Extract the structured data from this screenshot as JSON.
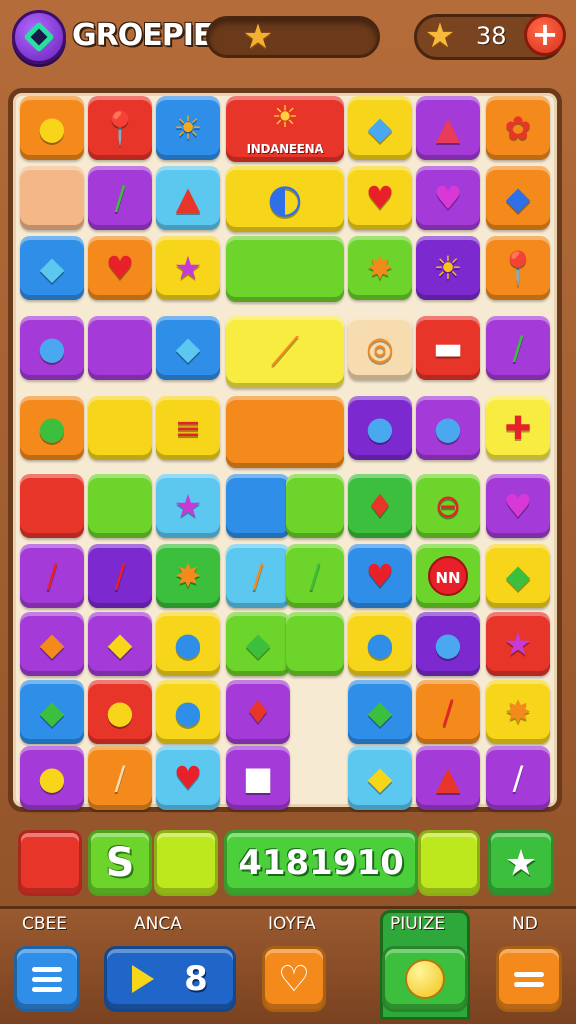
{
  "header": {
    "title": "GROEPIE",
    "coins": "38",
    "colors": {
      "accent": "#a43ad8",
      "plus": "#e8352a"
    }
  },
  "board": {
    "banner_text": "INDANEENA",
    "badge_text": "NN"
  },
  "bottom_row": {
    "letter": "S",
    "score": "4181910"
  },
  "nav": {
    "labels": [
      "CBEE",
      "ANCA",
      "IOYFA",
      "PIUIZE",
      "ND"
    ],
    "level": "8"
  },
  "icons": [
    "menu-icon",
    "play-icon",
    "heart-icon",
    "hint-bulb-icon",
    "shop-icon",
    "star-icon",
    "coin-icon",
    "plus-icon"
  ]
}
